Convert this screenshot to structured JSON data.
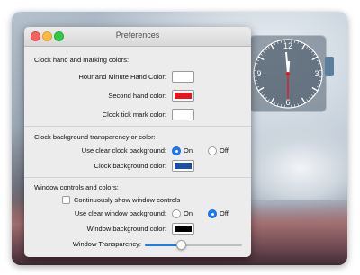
{
  "window": {
    "title": "Preferences"
  },
  "sections": {
    "hands": {
      "heading": "Clock hand and marking colors:",
      "hour_minute_label": "Hour and Minute Hand Color:",
      "hour_minute_color": "#ffffff",
      "second_label": "Second hand color:",
      "second_color": "#e8141b",
      "tick_label": "Clock tick mark color:",
      "tick_color": "#ffffff"
    },
    "background": {
      "heading": "Clock background transparency or color:",
      "clear_label": "Use clear clock background:",
      "on_label": "On",
      "off_label": "Off",
      "clear_selected": "On",
      "bg_label": "Clock background color:",
      "bg_color": "#1c4fa8"
    },
    "window_controls": {
      "heading": "Window controls and colors:",
      "show_controls_label": "Continuously show window controls",
      "show_controls_checked": false,
      "clear_window_label": "Use clear window background:",
      "on_label": "On",
      "off_label": "Off",
      "clear_window_selected": "Off",
      "window_bg_label": "Window background color:",
      "window_bg_color": "#000000",
      "transparency_label": "Window Transparency:",
      "transparency_value": 0.37
    }
  },
  "clock": {
    "numerals": [
      "12",
      "3",
      "6",
      "9"
    ],
    "hand_color": "#ffffff",
    "second_hand_color": "#e8141b"
  }
}
